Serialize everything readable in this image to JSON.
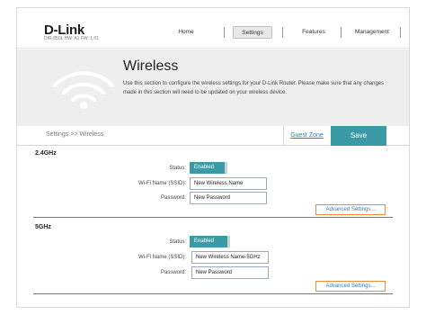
{
  "header": {
    "logo": "D-Link",
    "logo_sub": "DIR-850L   HW: A1   FW: 1.01",
    "nav": [
      "Home",
      "Settings",
      "Features",
      "Management"
    ]
  },
  "banner": {
    "title": "Wireless",
    "description": "Use this section to configure the wireless settings for your D-Link Router. Please make sure that any changes made in this section will need to be updated on your wireless device."
  },
  "breadcrumb": "Settings >> Wireless",
  "actions": {
    "guest_zone": "Guest Zone",
    "save": "Save"
  },
  "band_24": {
    "title": "2.4GHz",
    "status_label": "Status:",
    "status_value": "Enabled",
    "ssid_label": "Wi-Fi Name (SSID):",
    "ssid_value": "New Wireless Name",
    "password_label": "Password:",
    "password_value": "New Password",
    "advanced": "Advanced Settings..."
  },
  "band_5": {
    "title": "5GHz",
    "status_label": "Status:",
    "status_value": "Enabled",
    "ssid_label": "Wi-Fi Name (SSID):",
    "ssid_value": "New Wireless Name-5GHz",
    "password_label": "Password:",
    "password_value": "New Password",
    "advanced": "Advanced Settings..."
  },
  "colors": {
    "accent": "#3a9aa6",
    "highlight": "#f08a3a",
    "link": "#2a7bbf"
  }
}
